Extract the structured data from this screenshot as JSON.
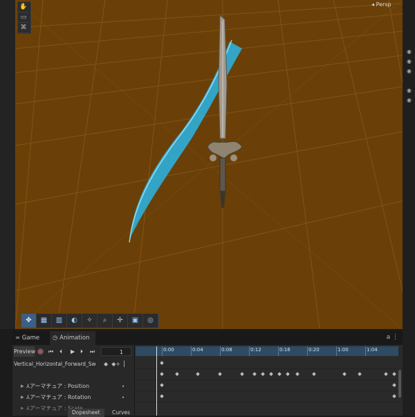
{
  "scene": {
    "camera_mode": "Persp",
    "tools": [
      "hand-icon",
      "rect-icon",
      "transform-icon"
    ]
  },
  "viewport_toolbar": {
    "icons": [
      "move-icon",
      "grid-icon",
      "snap-icon",
      "shading-icon",
      "light-icon",
      "zoom-icon",
      "pivot-icon",
      "camera-icon",
      "compass-icon"
    ]
  },
  "tabs": {
    "game": "Game",
    "animation": "Animation"
  },
  "animation": {
    "preview_label": "Preview",
    "frame_value": "1",
    "clip_name": "Vertical_Horizontal_Forward_Swi",
    "properties": [
      {
        "label": "アーマチュア : Position"
      },
      {
        "label": "アーマチュア : Rotation"
      },
      {
        "label": "アーマチュア : Scale"
      }
    ],
    "ruler_labels": [
      "0:00",
      "0:04",
      "0:08",
      "0:12",
      "0:16",
      "0:20",
      "1:00",
      "1:04"
    ],
    "bottom_tabs": [
      "Dopesheet",
      "Curves"
    ]
  },
  "colors": {
    "viewport_bg": "#6a4008",
    "trail": "#29b6e6",
    "ruler": "#2f4a63"
  }
}
